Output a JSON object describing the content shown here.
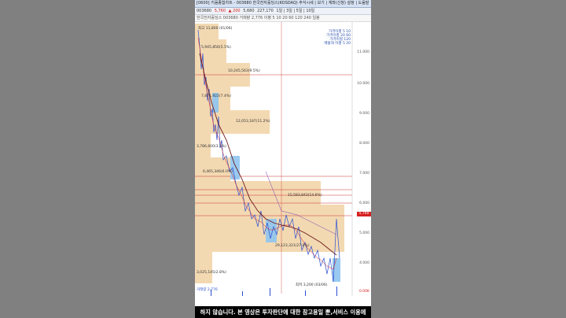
{
  "window": {
    "title": "[0600] 키움종합차트 - 003680 한국전자홀딩스(KOSDAQ) 주식시세 | 보기 | 계좌(신청) 설정 | 도움말"
  },
  "toolbar": {
    "code": "003680",
    "price": "5,760",
    "change": "▲ 200",
    "open": "5,680",
    "volume": "227,170",
    "range_label": "1일 | 3일 | 5일 | 10일"
  },
  "infobar": {
    "text": "한국전자홀딩스 003680  거래량 2,776  이평 5 10 20 60 120 240  일봉"
  },
  "chart": {
    "max_label": "최고 11,800 (01/06)",
    "min_label": "최저 3,200 (03/06)",
    "volume_label": "거래량 2,776",
    "legend": [
      "가격이평 5 10",
      "가격이평 20 60",
      "가격이평 120",
      "매물대 이평 5 20"
    ],
    "volume_profile": [
      "5,945,856(5.5%)",
      "10,245,563(9.5%)",
      "7,871,922(7.4%)",
      "12,053,187(11.2%)",
      "3,786,600(3.5%)",
      "6,465,346(6.0%)",
      "15,583,843(14.6%)",
      "29,123,321(27.0%)",
      "3,025,145(2.8%)"
    ],
    "y_axis": [
      "11.000",
      "10.000",
      "9.000",
      "8.000",
      "7.000",
      "6.000",
      "5.000",
      "4.000"
    ],
    "current_price": "5,760",
    "volume_axis": "0.00K"
  },
  "subtitle": "하지 않습니다. 본 영상은 투자판단에 대한 참고용일 뿐,서비스 이용에",
  "colors": {
    "volume_profile_bar": "#f3d9b2",
    "candle_down": "#2b4fd0",
    "candle_up": "#d62020",
    "ma_dark": "#6b1a1a",
    "highlight_band": "#8fc4f0"
  }
}
